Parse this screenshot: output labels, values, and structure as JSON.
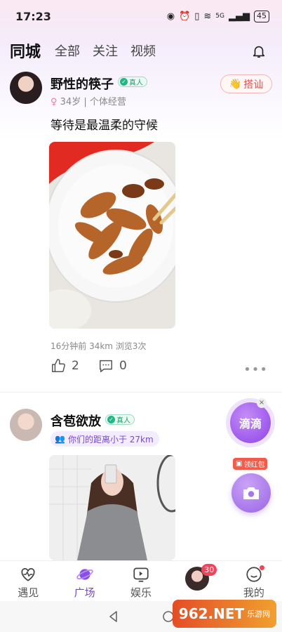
{
  "status_bar": {
    "time": "17:23",
    "network": "5G",
    "battery": "45"
  },
  "tabs": [
    {
      "label": "同城",
      "active": true
    },
    {
      "label": "全部",
      "active": false
    },
    {
      "label": "关注",
      "active": false
    },
    {
      "label": "视频",
      "active": false
    }
  ],
  "posts": [
    {
      "username": "野性的筷子",
      "verified_label": "真人",
      "meta": "34岁 | 个体经营",
      "greet_label": "搭讪",
      "text": "等待是最温柔的守候",
      "post_meta": "16分钟前  34km  浏览3次",
      "likes": "2",
      "comments": "0"
    },
    {
      "username": "含苞欲放",
      "verified_label": "真人",
      "distance": "你们的距离小于 27km"
    }
  ],
  "floating": {
    "didi_label": "滴滴",
    "close_label": "×",
    "red_envelope_label": "领红包"
  },
  "bottom_nav": [
    {
      "label": "遇见",
      "active": false
    },
    {
      "label": "广场",
      "active": true
    },
    {
      "label": "娱乐",
      "active": false
    },
    {
      "label": "",
      "badge": "30"
    },
    {
      "label": "我的",
      "active": false
    }
  ],
  "watermark": {
    "text": "962.NET",
    "sub": "乐游网"
  },
  "colors": {
    "accent": "#7a45d6",
    "verified": "#1fb783",
    "badge": "#f0445a"
  }
}
